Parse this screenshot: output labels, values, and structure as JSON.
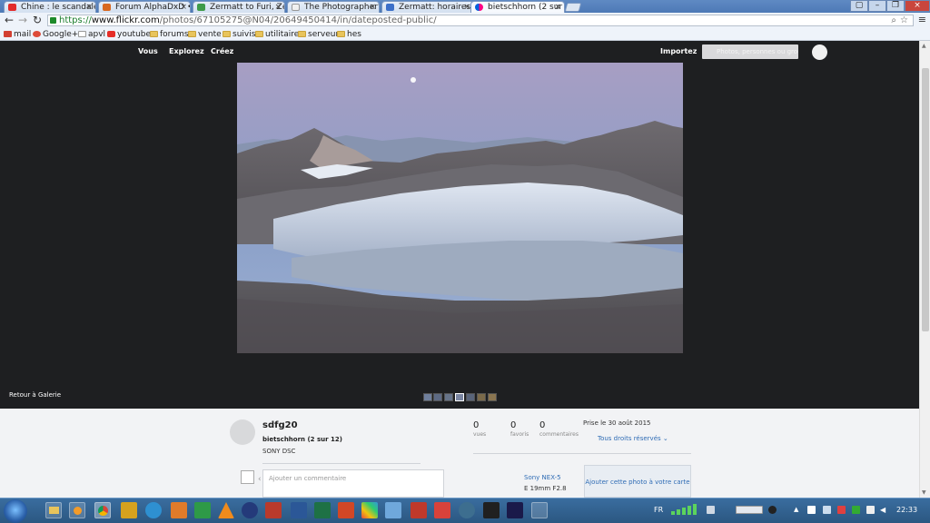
{
  "browser": {
    "tabs": [
      {
        "label": "Chine : le scandale d",
        "color": "#e22b2b"
      },
      {
        "label": "Forum AlphaDxD • C",
        "color": "#d8681f"
      },
      {
        "label": "Zermatt to Furi, Zerm",
        "color": "#3f9b4a"
      },
      {
        "label": "The Photographer's",
        "color": "#f0f0f0"
      },
      {
        "label": "Zermatt: horaires et",
        "color": "#3b6fc9"
      },
      {
        "label": "bietschhorn (2 sur 12",
        "color": "#ff0084",
        "active": true
      }
    ],
    "url": {
      "scheme": "https://",
      "host": "www.flickr.com",
      "path": "/photos/67105275@N04/20649450414/in/dateposted-public/"
    },
    "bookmarks": [
      {
        "label": "mail",
        "icon": "gmail"
      },
      {
        "label": "Google+",
        "icon": "gplus"
      },
      {
        "label": "apvl",
        "icon": "page"
      },
      {
        "label": "youtube",
        "icon": "yt"
      },
      {
        "label": "forums",
        "icon": "folder"
      },
      {
        "label": "vente",
        "icon": "folder"
      },
      {
        "label": "suivis",
        "icon": "folder"
      },
      {
        "label": "utilitaire",
        "icon": "folder"
      },
      {
        "label": "serveur",
        "icon": "folder"
      },
      {
        "label": "hes",
        "icon": "folder"
      }
    ]
  },
  "flickr_nav": {
    "vous": "Vous",
    "explorez": "Explorez",
    "creez": "Créez",
    "importez": "Importez",
    "search_placeholder": "Photos, personnes ou groupes"
  },
  "viewer": {
    "retour": "Retour à Galerie"
  },
  "info": {
    "owner": "sdfg20",
    "title": "bietschhorn (2 sur 12)",
    "description": "SONY DSC",
    "stats": [
      {
        "value": "0",
        "label": "vues"
      },
      {
        "value": "0",
        "label": "favoris"
      },
      {
        "value": "0",
        "label": "commentaires"
      }
    ],
    "taken": "Prise le 30 août 2015",
    "rights": "Tous droits réservés",
    "comment_placeholder": "Ajouter un commentaire",
    "camera": "Sony NEX-5",
    "lens": "E 19mm F2.8",
    "cart": "Ajouter cette photo à votre carte"
  },
  "taskbar": {
    "lang": "FR",
    "clock": "22:33"
  }
}
